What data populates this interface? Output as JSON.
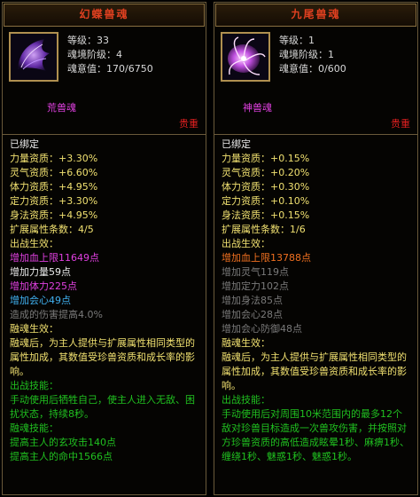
{
  "left": {
    "title": "幻蝶兽魂",
    "level": "等级：33",
    "realm": "魂境阶级：4",
    "soul_will": "魂意值：170/6750",
    "soul_type": "荒兽魂",
    "rank": "贵重",
    "bound": "已绑定",
    "aptitudes": [
      "力量资质：+3.30%",
      "灵气资质：+6.60%",
      "体力资质：+4.95%",
      "定力资质：+3.30%",
      "身法资质：+4.95%"
    ],
    "ext_count": "扩展属性条数：4/5",
    "battle_label": "出战生效：",
    "battle_effects": [
      {
        "text": "增加血上限11649点",
        "color": "magenta"
      },
      {
        "text": "增加力量59点",
        "color": "white"
      },
      {
        "text": "增加体力225点",
        "color": "magenta"
      },
      {
        "text": "增加会心49点",
        "color": "cyan"
      },
      {
        "text": "造成的伤害提高4.0%",
        "color": "gray"
      }
    ],
    "fusion_label": "融魂生效：",
    "fusion_desc": "融魂后，为主人提供与扩展属性相同类型的属性加成，其数值受珍兽资质和成长率的影响。",
    "battle_skill_label": "出战技能：",
    "battle_skill_desc": "手动使用后牺牲自己，使主人进入无敌、困扰状态，持续8秒。",
    "fusion_skill_label": "融魂技能：",
    "fusion_skills": [
      "提高主人的玄攻击140点",
      "提高主人的命中1566点"
    ]
  },
  "right": {
    "title": "九尾兽魂",
    "level": "等级：1",
    "realm": "魂境阶级：1",
    "soul_will": "魂意值：0/600",
    "soul_type": "神兽魂",
    "rank": "贵重",
    "bound": "已绑定",
    "aptitudes": [
      "力量资质：+0.15%",
      "灵气资质：+0.20%",
      "体力资质：+0.30%",
      "定力资质：+0.10%",
      "身法资质：+0.15%"
    ],
    "ext_count": "扩展属性条数：1/6",
    "battle_label": "出战生效：",
    "battle_effects": [
      {
        "text": "增加血上限13788点",
        "color": "orange"
      },
      {
        "text": "增加灵气119点",
        "color": "gray"
      },
      {
        "text": "增加定力102点",
        "color": "gray"
      },
      {
        "text": "增加身法85点",
        "color": "gray"
      },
      {
        "text": "增加会心28点",
        "color": "gray"
      },
      {
        "text": "增加会心防御48点",
        "color": "gray"
      }
    ],
    "fusion_label": "融魂生效：",
    "fusion_desc": "融魂后，为主人提供与扩展属性相同类型的属性加成，其数值受珍兽资质和成长率的影响。",
    "battle_skill_label": "出战技能：",
    "battle_skill_desc": "手动使用后对周围10米范围内的最多12个敌对珍兽目标造成一次兽攻伤害，并按照对方珍兽资质的高低造成眩晕1秒、麻痹1秒、缠绕1秒、魅惑1秒、魅惑1秒。"
  },
  "colors": {
    "title": "#e04020",
    "rank": "#e02020",
    "soul_type": "#e040e0",
    "label": "#f0e070",
    "skill_label": "#20c020",
    "aptitude": "#f0e070"
  },
  "icons": {
    "left": "purple-butterfly-wing-icon",
    "right": "nine-tailed-fox-icon"
  }
}
